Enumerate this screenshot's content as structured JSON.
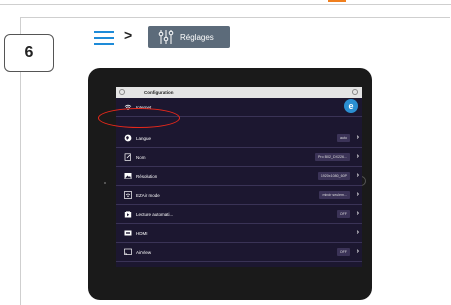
{
  "step": {
    "number": "6"
  },
  "breadcrumb": {
    "separator": ">",
    "settings_label": "Réglages"
  },
  "colors": {
    "accent": "#1e8bd8",
    "highlight": "#e8281a",
    "orange": "#f07f1e"
  },
  "screen": {
    "title": "Configuration",
    "rows": [
      {
        "icon": "wifi-icon",
        "label": "Internet",
        "value": "",
        "has_chevron": false
      },
      {
        "icon": "globe-icon",
        "label": "Langue",
        "value": "auto",
        "has_chevron": true
      },
      {
        "icon": "edit-icon",
        "label": "Nom",
        "value": "Pro B02_DX226...",
        "has_chevron": true
      },
      {
        "icon": "image-icon",
        "label": "Résolution",
        "value": "1920x1080_60P",
        "has_chevron": true
      },
      {
        "icon": "screen-share-icon",
        "label": "EZAir mode",
        "value": "miroir seulem...",
        "has_chevron": true
      },
      {
        "icon": "play-icon",
        "label": "Lecture automati...",
        "value": "OFF",
        "has_chevron": true
      },
      {
        "icon": "hdmi-icon",
        "label": "HDMI",
        "value": "",
        "has_chevron": true
      },
      {
        "icon": "cast-icon",
        "label": "AirView",
        "value": "OFF",
        "has_chevron": true
      }
    ]
  }
}
